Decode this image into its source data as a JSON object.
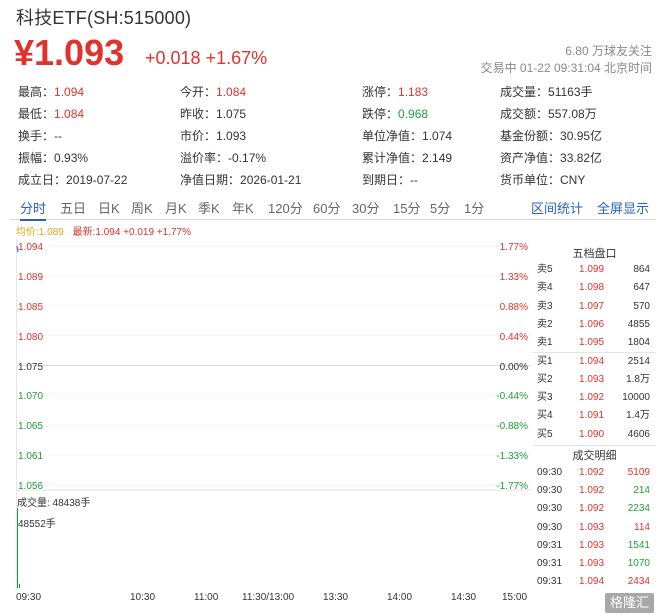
{
  "header": {
    "title": "科技ETF(SH:515000)",
    "price": "¥1.093",
    "change": "+0.018 +1.67%",
    "followers": "6.80 万球友关注",
    "trade_time": "交易中 01-22 09:31:04 北京时间"
  },
  "stats": [
    {
      "label": "最高：",
      "value": "1.094",
      "tone": "red"
    },
    {
      "label": "今开：",
      "value": "1.084",
      "tone": "red"
    },
    {
      "label": "涨停：",
      "value": "1.183",
      "tone": "red"
    },
    {
      "label": "成交量：",
      "value": "51163手",
      "tone": "normal"
    },
    {
      "label": "最低：",
      "value": "1.084",
      "tone": "red"
    },
    {
      "label": "昨收：",
      "value": "1.075",
      "tone": "normal"
    },
    {
      "label": "跌停：",
      "value": "0.968",
      "tone": "green"
    },
    {
      "label": "成交额：",
      "value": "557.08万",
      "tone": "normal"
    },
    {
      "label": "换手：",
      "value": "--",
      "tone": "normal"
    },
    {
      "label": "市价：",
      "value": "1.093",
      "tone": "normal"
    },
    {
      "label": "单位净值：",
      "value": "1.074",
      "tone": "normal"
    },
    {
      "label": "基金份额：",
      "value": "30.95亿",
      "tone": "normal"
    },
    {
      "label": "振幅：",
      "value": "0.93%",
      "tone": "normal"
    },
    {
      "label": "溢价率：",
      "value": "-0.17%",
      "tone": "normal"
    },
    {
      "label": "累计净值：",
      "value": "2.149",
      "tone": "normal"
    },
    {
      "label": "资产净值：",
      "value": "33.82亿",
      "tone": "normal"
    },
    {
      "label": "成立日：",
      "value": "2019-07-22",
      "tone": "normal"
    },
    {
      "label": "净值日期：",
      "value": "2026-01-21",
      "tone": "normal"
    },
    {
      "label": "到期日：",
      "value": "--",
      "tone": "normal"
    },
    {
      "label": "货币单位：",
      "value": "CNY",
      "tone": "normal"
    }
  ],
  "tabs": [
    "分时",
    "五日",
    "日K",
    "周K",
    "月K",
    "季K",
    "年K",
    "120分",
    "60分",
    "30分",
    "15分",
    "5分",
    "1分"
  ],
  "active_tab": "分时",
  "tab_links": [
    "区间统计",
    "全屏显示"
  ],
  "chart_legend": {
    "avg": "均价:1.089",
    "latest": "最新:1.094 +0.019 +1.77%"
  },
  "chart_data": {
    "type": "line",
    "price_ticks": [
      "1.094",
      "1.089",
      "1.085",
      "1.080",
      "1.075",
      "1.070",
      "1.065",
      "1.061",
      "1.056"
    ],
    "pct_ticks": [
      "1.77%",
      "1.33%",
      "0.88%",
      "0.44%",
      "0.00%",
      "-0.44%",
      "-0.88%",
      "-1.33%",
      "-1.77%"
    ],
    "ylim": [
      1.056,
      1.094
    ],
    "prev_close": 1.075,
    "x_ticks": [
      "09:30",
      "10:30",
      "11:00",
      "11:30/13:00",
      "13:30",
      "14:00",
      "14:30",
      "15:00"
    ],
    "volume_label": "成交量: 48438手",
    "volume_max_label": "48552手",
    "volume": [
      {
        "time": "09:30",
        "value": 48552
      },
      {
        "time": "09:31",
        "value": 2611
      }
    ],
    "colors": {
      "up": "#e1322d",
      "down": "#1e9d3b",
      "flat": "#333333",
      "grid": "#eeeeee"
    }
  },
  "order_book": {
    "title": "五档盘口",
    "rows": [
      {
        "label": "卖5",
        "price": "1.099",
        "volume": "864",
        "tone": "red"
      },
      {
        "label": "卖4",
        "price": "1.098",
        "volume": "647",
        "tone": "red"
      },
      {
        "label": "卖3",
        "price": "1.097",
        "volume": "570",
        "tone": "red"
      },
      {
        "label": "卖2",
        "price": "1.096",
        "volume": "4855",
        "tone": "red"
      },
      {
        "label": "卖1",
        "price": "1.095",
        "volume": "1804",
        "tone": "red"
      },
      {
        "label": "买1",
        "price": "1.094",
        "volume": "2514",
        "tone": "red"
      },
      {
        "label": "买2",
        "price": "1.093",
        "volume": "1.8万",
        "tone": "red"
      },
      {
        "label": "买3",
        "price": "1.092",
        "volume": "10000",
        "tone": "red"
      },
      {
        "label": "买4",
        "price": "1.091",
        "volume": "1.4万",
        "tone": "red"
      },
      {
        "label": "买5",
        "price": "1.090",
        "volume": "4606",
        "tone": "red"
      }
    ]
  },
  "trades": {
    "title": "成交明细",
    "rows": [
      {
        "time": "09:30",
        "price": "1.092",
        "volume": "5109",
        "tone": "red"
      },
      {
        "time": "09:30",
        "price": "1.092",
        "volume": "214",
        "tone": "green"
      },
      {
        "time": "09:30",
        "price": "1.092",
        "volume": "2234",
        "tone": "green"
      },
      {
        "time": "09:30",
        "price": "1.093",
        "volume": "114",
        "tone": "red"
      },
      {
        "time": "09:31",
        "price": "1.093",
        "volume": "1541",
        "tone": "green"
      },
      {
        "time": "09:31",
        "price": "1.093",
        "volume": "1070",
        "tone": "green"
      },
      {
        "time": "09:31",
        "price": "1.094",
        "volume": "2434",
        "tone": "red"
      }
    ]
  },
  "watermark": "格隆汇"
}
